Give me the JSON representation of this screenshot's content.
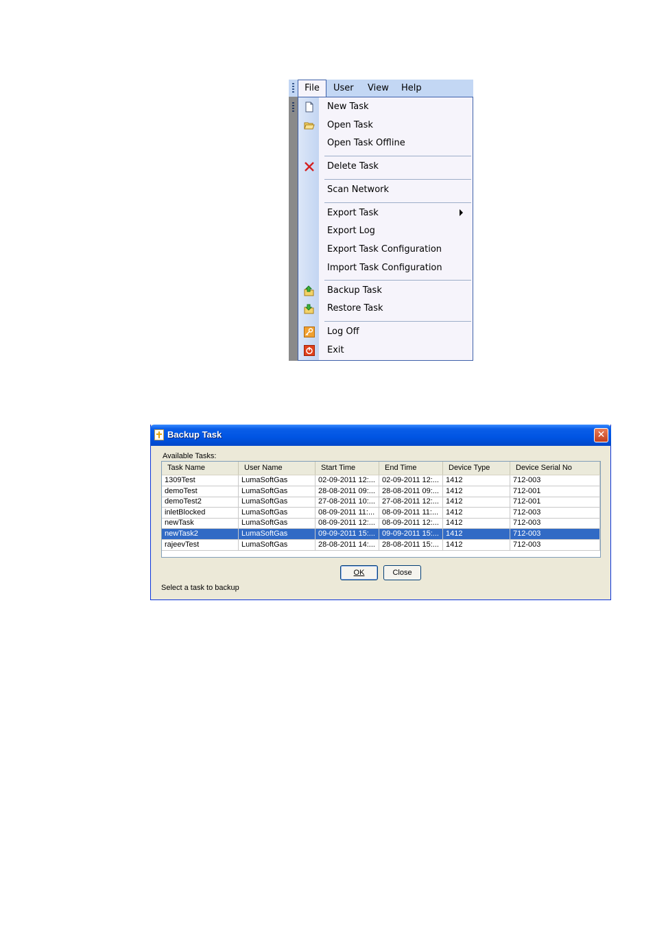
{
  "menu": {
    "menubar": [
      "File",
      "User",
      "View",
      "Help"
    ],
    "items": [
      {
        "label": "New Task",
        "icon": "new-document-icon"
      },
      {
        "label": "Open Task",
        "icon": "folder-open-icon"
      },
      {
        "label": "Open Task Offline",
        "icon": ""
      },
      {
        "label": "Delete Task",
        "icon": "delete-x-icon"
      },
      {
        "label": "Scan Network",
        "icon": ""
      },
      {
        "label": "Export Task",
        "icon": "",
        "submenu": true
      },
      {
        "label": "Export Log",
        "icon": ""
      },
      {
        "label": "Export Task Configuration",
        "icon": ""
      },
      {
        "label": "Import Task Configuration",
        "icon": ""
      },
      {
        "label": "Backup Task",
        "icon": "backup-folder-icon"
      },
      {
        "label": "Restore Task",
        "icon": "restore-folder-icon"
      },
      {
        "label": "Log Off",
        "icon": "key-icon"
      },
      {
        "label": "Exit",
        "icon": "power-icon"
      }
    ]
  },
  "dialog": {
    "title": "Backup Task",
    "close_glyph": "✕",
    "available_label": "Available Tasks:",
    "columns": [
      "Task Name",
      "User Name",
      "Start Time",
      "End Time",
      "Device Type",
      "Device Serial No"
    ],
    "rows": [
      [
        "1309Test",
        "LumaSoftGas",
        "02-09-2011 12:...",
        "02-09-2011 12:...",
        "1412",
        "712-003"
      ],
      [
        "demoTest",
        "LumaSoftGas",
        "28-08-2011 09:...",
        "28-08-2011 09:...",
        "1412",
        "712-001"
      ],
      [
        "demoTest2",
        "LumaSoftGas",
        "27-08-2011 10:...",
        "27-08-2011 12:...",
        "1412",
        "712-001"
      ],
      [
        "inletBlocked",
        "LumaSoftGas",
        "08-09-2011 11:...",
        "08-09-2011 11:...",
        "1412",
        "712-003"
      ],
      [
        "newTask",
        "LumaSoftGas",
        "08-09-2011 12:...",
        "08-09-2011 12:...",
        "1412",
        "712-003"
      ],
      [
        "newTask2",
        "LumaSoftGas",
        "09-09-2011 15:...",
        "09-09-2011 15:...",
        "1412",
        "712-003"
      ],
      [
        "rajeevTest",
        "LumaSoftGas",
        "28-08-2011 14:...",
        "28-08-2011 15:...",
        "1412",
        "712-003"
      ]
    ],
    "selected_row": "newTask2",
    "ok_label": "OK",
    "close_label": "Close",
    "status_text": "Select a task to backup"
  },
  "colors": {
    "selection": "#316ac5",
    "titlebar": "#0054e3",
    "menubar": "#c3d7f4"
  }
}
